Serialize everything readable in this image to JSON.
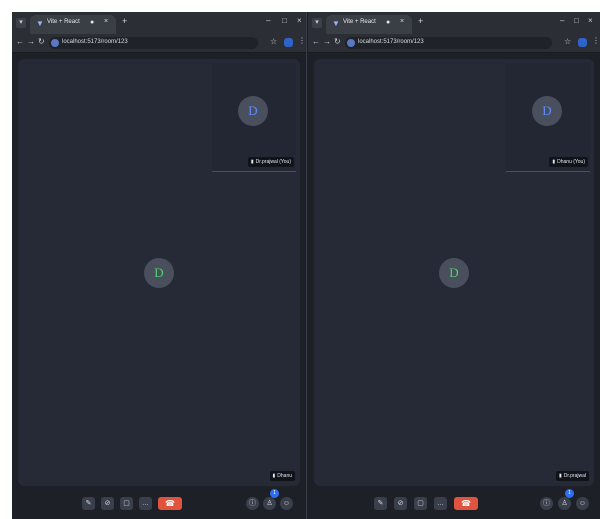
{
  "colors": {
    "accent": "#2f6ef0",
    "hangup": "#e0533e",
    "avatar_main": "#4dd06b",
    "avatar_pip": "#5d8cff"
  },
  "left": {
    "tab_title": "Vite + React",
    "url": "localhost:5173/room/123",
    "pip_avatar": "D",
    "pip_name": "Dr.prajwal (You)",
    "main_avatar": "D",
    "main_name": "Dhanu",
    "participants_badge": "1"
  },
  "right": {
    "tab_title": "Vite + React",
    "url": "localhost:5173/room/123",
    "pip_avatar": "D",
    "pip_name": "Dhanu (You)",
    "main_avatar": "D",
    "main_name": "Dr.prajwal",
    "participants_badge": "1"
  },
  "icons": {
    "tab_close": "×",
    "new_tab": "+",
    "more": "…",
    "hangup": "☎"
  }
}
